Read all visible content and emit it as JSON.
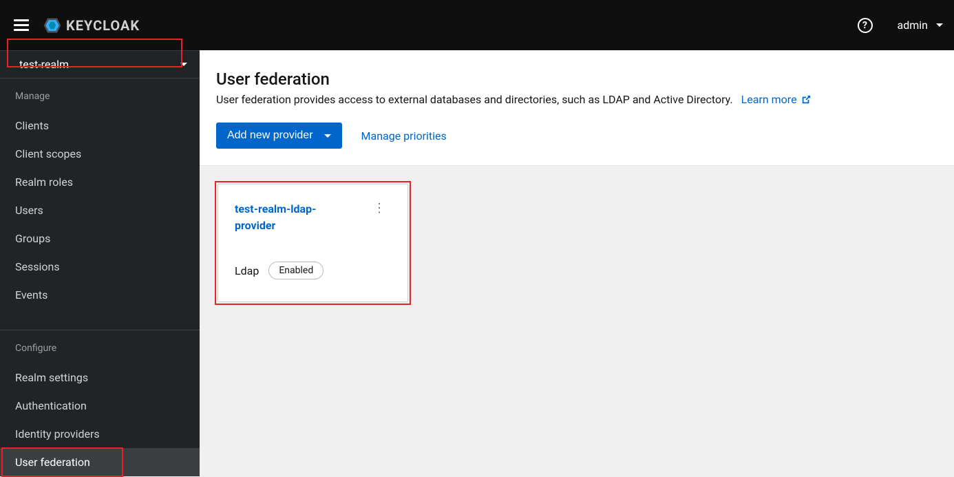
{
  "app": {
    "brand": "KEYCLOAK",
    "user": "admin"
  },
  "realm_selector": {
    "current": "test-realm"
  },
  "sidebar": {
    "manage_heading": "Manage",
    "manage_items": [
      {
        "label": "Clients"
      },
      {
        "label": "Client scopes"
      },
      {
        "label": "Realm roles"
      },
      {
        "label": "Users"
      },
      {
        "label": "Groups"
      },
      {
        "label": "Sessions"
      },
      {
        "label": "Events"
      }
    ],
    "configure_heading": "Configure",
    "configure_items": [
      {
        "label": "Realm settings"
      },
      {
        "label": "Authentication"
      },
      {
        "label": "Identity providers"
      },
      {
        "label": "User federation"
      }
    ],
    "active": "User federation"
  },
  "page": {
    "title": "User federation",
    "description": "User federation provides access to external databases and directories, such as LDAP and Active Directory.",
    "learn_more": "Learn more",
    "add_provider": "Add new provider",
    "manage_priorities": "Manage priorities"
  },
  "providers": [
    {
      "name": "test-realm-ldap-provider",
      "type": "Ldap",
      "status": "Enabled"
    }
  ],
  "colors": {
    "primary": "#0066cc",
    "topbar": "#0f0f0f",
    "sidebar": "#212427",
    "highlight": "#e62325"
  }
}
